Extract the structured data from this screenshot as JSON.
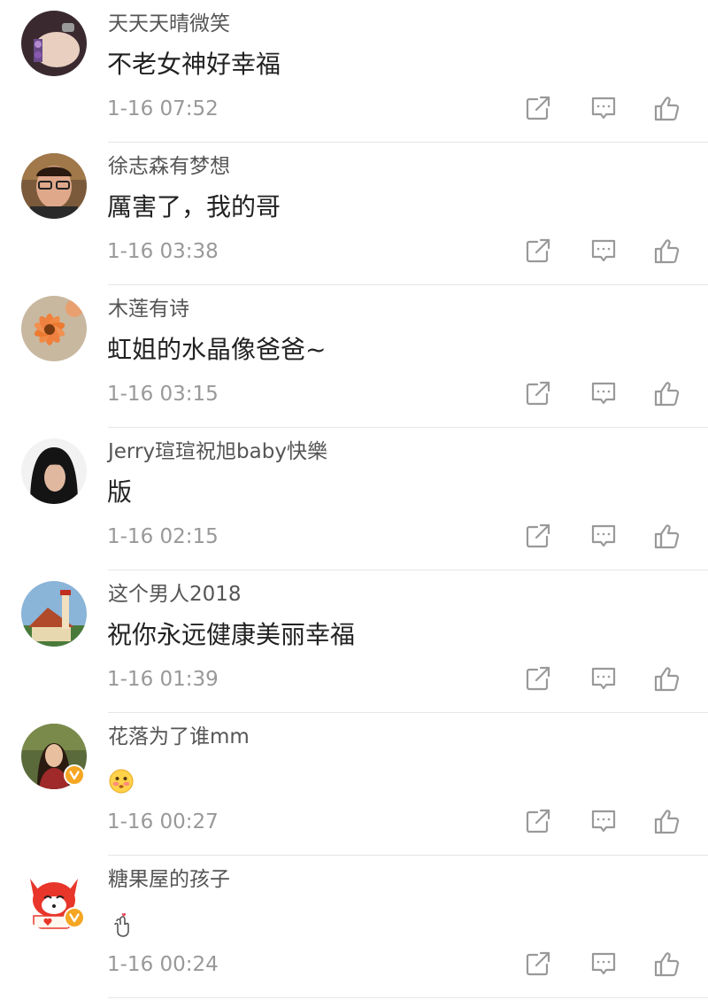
{
  "comments": [
    {
      "username": "天天天晴微笑",
      "text": "不老女神好幸福",
      "time": "1-16 07:52"
    },
    {
      "username": "徐志森有梦想",
      "text": "厲害了，我的哥",
      "time": "1-16 03:38"
    },
    {
      "username": "木莲有诗",
      "text": "虹姐的水晶像爸爸~",
      "time": "1-16 03:15"
    },
    {
      "username": "Jerry瑄瑄祝旭baby快樂",
      "text": "版",
      "time": "1-16 02:15"
    },
    {
      "username": "这个男人2018",
      "text": "祝你永远健康美丽幸福",
      "time": "1-16 01:39"
    },
    {
      "username": "花落为了谁mm",
      "text": "",
      "emoji": "blushing-face-emoji",
      "verified": true,
      "time": "1-16 00:27"
    },
    {
      "username": "糖果屋的孩子",
      "text": "",
      "emoji": "finger-heart-emoji",
      "verified": true,
      "time": "1-16 00:24"
    }
  ],
  "icons": {
    "share": "share-icon",
    "comment": "comment-icon",
    "like": "thumbs-up-icon"
  },
  "colors": {
    "username": "#555555",
    "text": "#222222",
    "meta": "#999999",
    "icon": "#999999",
    "divider": "#e6e6e6",
    "verified_badge": "#f5a623"
  }
}
